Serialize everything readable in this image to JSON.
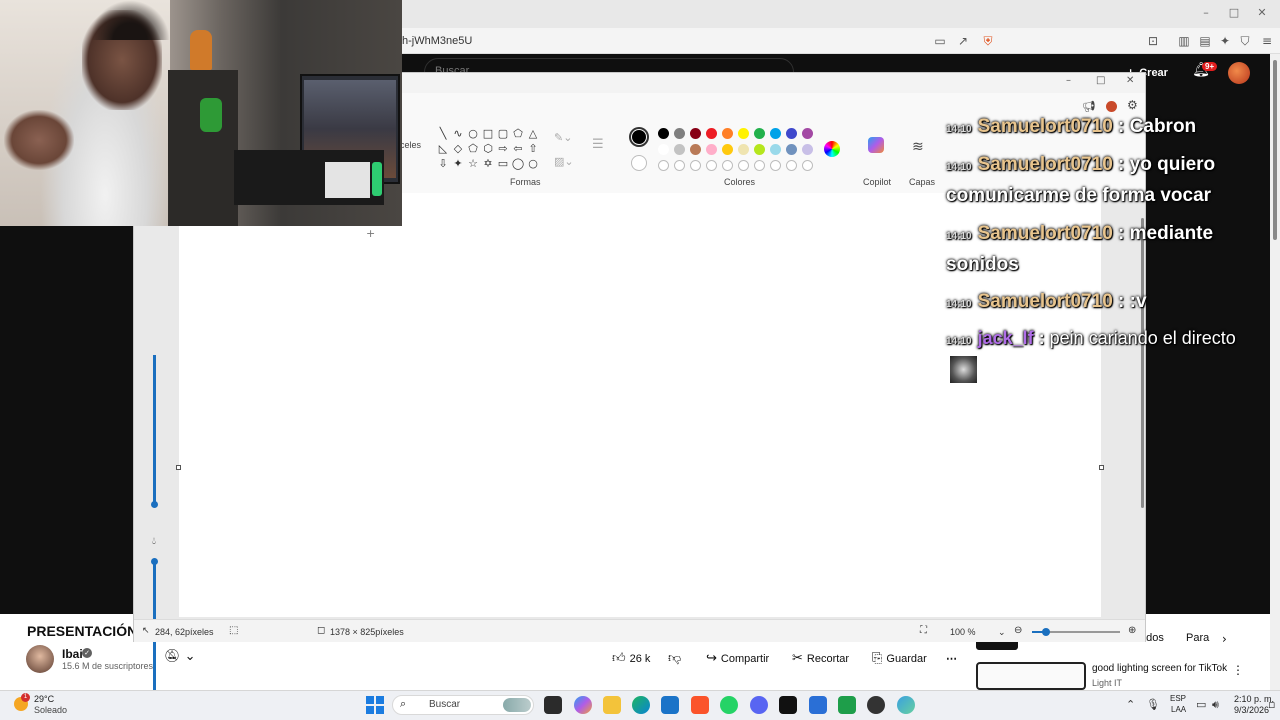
{
  "browser": {
    "url_fragment": "h-jWhM3ne5U",
    "window_controls": {
      "minimize": "–",
      "maximize": "□",
      "close": "✕"
    }
  },
  "youtube": {
    "search_placeholder": "Buscar",
    "create_label": "Crear",
    "notif_count": "9+",
    "video_title": "PRESENTACIÓN V",
    "channel": {
      "name": "Ibai",
      "subscribers": "15.6 M de suscriptores"
    },
    "actions": {
      "likes": "26 k",
      "share": "Compartir",
      "clip": "Recortar",
      "save": "Guardar",
      "more": "⋯"
    },
    "chips": [
      "ados",
      "Para"
    ],
    "recommended": {
      "title": "good lighting screen for TikTok",
      "channel": "Light IT"
    }
  },
  "paint": {
    "ribbon_labels": {
      "tools_partial": "celes",
      "shapes": "Formas",
      "colors": "Colores",
      "copilot": "Copilot",
      "layers": "Capas"
    },
    "palette_row1": [
      "#000000",
      "#7f7f7f",
      "#880015",
      "#ed1c24",
      "#ff7f27",
      "#fff200",
      "#22b14c",
      "#00a2e8",
      "#3f48cc",
      "#a349a4"
    ],
    "palette_row2": [
      "#ffffff",
      "#c3c3c3",
      "#b97a57",
      "#ffaec9",
      "#ffc90e",
      "#efe4b0",
      "#b5e61d",
      "#99d9ea",
      "#7092be",
      "#c8bfe7"
    ],
    "selected_color": "#000000",
    "status": {
      "cursor_pos": "284, 62píxeles",
      "canvas_size": "1378 × 825píxeles",
      "zoom": "100 %"
    }
  },
  "chat": {
    "messages": [
      {
        "time": "14:10",
        "user": "Samuelort0710",
        "text": "Cabron"
      },
      {
        "time": "14:10",
        "user": "Samuelort0710",
        "text": "yo quiero",
        "wrap": "comunicarme de forma vocar"
      },
      {
        "time": "14:10",
        "user": "Samuelort0710",
        "text": "mediante",
        "wrap": "sonidos"
      },
      {
        "time": "14:10",
        "user": "Samuelort0710",
        "text": ":v"
      },
      {
        "time": "14:10",
        "user": "jack_lf",
        "text": "pein cariando el directo"
      }
    ],
    "separator": ":"
  },
  "taskbar": {
    "weather": {
      "temp": "29°C",
      "condition": "Soleado",
      "badge": "1"
    },
    "search_label": "Buscar",
    "lang": {
      "line1": "ESP",
      "line2": "LAA"
    },
    "time": "2:10 p. m.",
    "date": "9/3/2026"
  }
}
